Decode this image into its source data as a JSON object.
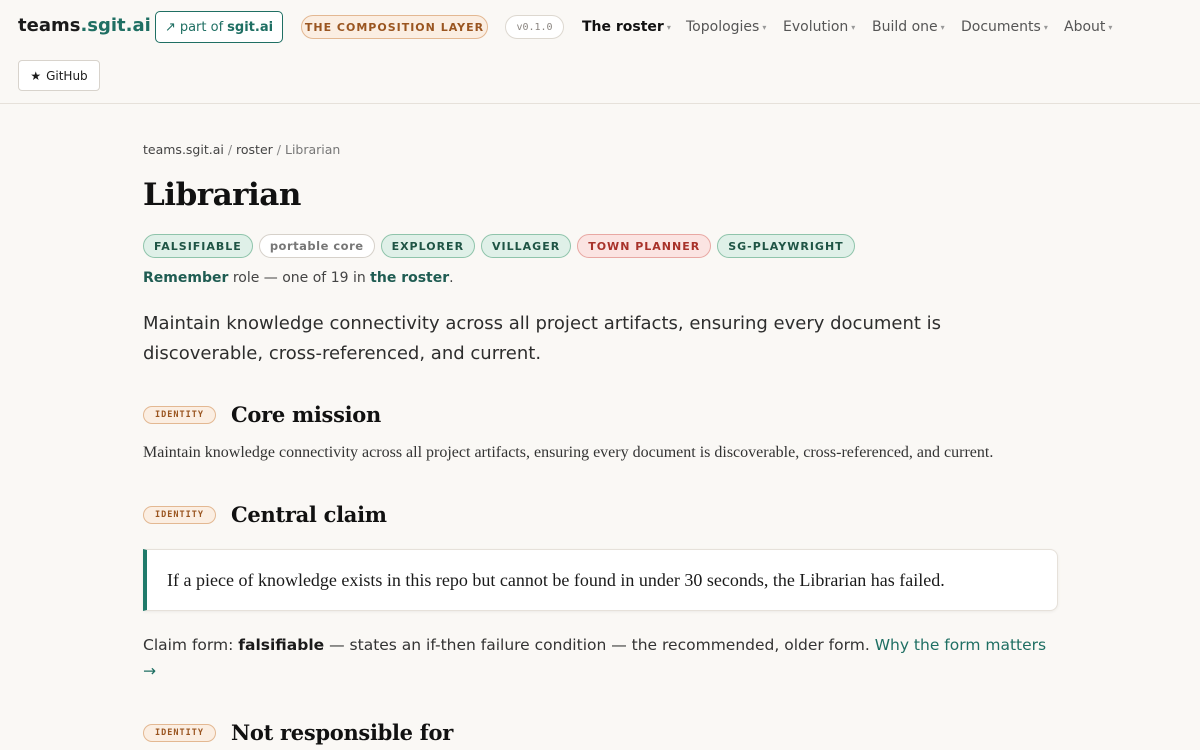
{
  "header": {
    "logo_main": "teams",
    "logo_accent": ".sgit.ai",
    "part_of_arrow": "↗",
    "part_of_prefix": "part of",
    "part_of_site": "sgit.ai",
    "layer_label": "THE COMPOSITION LAYER",
    "version": "v0.1.0",
    "nav": [
      {
        "label": "The roster",
        "active": true
      },
      {
        "label": "Topologies",
        "active": false
      },
      {
        "label": "Evolution",
        "active": false
      },
      {
        "label": "Build one",
        "active": false
      },
      {
        "label": "Documents",
        "active": false
      },
      {
        "label": "About",
        "active": false
      }
    ],
    "caret": "▾",
    "github_star": "★",
    "github_label": "GitHub"
  },
  "breadcrumb": {
    "root": "teams.sgit.ai",
    "sep": "/",
    "section": "roster",
    "current": "Librarian"
  },
  "page": {
    "title": "Librarian",
    "tags": [
      {
        "label": "FALSIFIABLE",
        "style": "green"
      },
      {
        "label": "portable core",
        "style": "outline"
      },
      {
        "label": "EXPLORER",
        "style": "green"
      },
      {
        "label": "VILLAGER",
        "style": "green"
      },
      {
        "label": "TOWN PLANNER",
        "style": "red"
      },
      {
        "label": "SG-PLAYWRIGHT",
        "style": "green"
      }
    ],
    "role": {
      "name": "Remember",
      "middle": " role — one of 19 in ",
      "roster_link": "the roster",
      "end": "."
    },
    "lede": "Maintain knowledge connectivity across all project artifacts, ensuring every document is discoverable, cross-referenced, and current."
  },
  "sections": {
    "identity_label": "IDENTITY",
    "core_mission": {
      "title": "Core mission",
      "text": "Maintain knowledge connectivity across all project artifacts, ensuring every document is discoverable, cross-referenced, and current."
    },
    "central_claim": {
      "title": "Central claim",
      "quote": "If a piece of knowledge exists in this repo but cannot be found in under 30 seconds, the Librarian has failed.",
      "form_prefix": "Claim form: ",
      "form_value": "falsifiable",
      "form_desc": " — states an if-then failure condition — the recommended, older form. ",
      "form_link": "Why the form matters →"
    },
    "not_responsible": {
      "title": "Not responsible for"
    }
  },
  "colors": {
    "accent": "#1f6f63",
    "background": "#faf8f5",
    "identity_pill": "#fbeee2",
    "tag_red": "#a8322a"
  }
}
